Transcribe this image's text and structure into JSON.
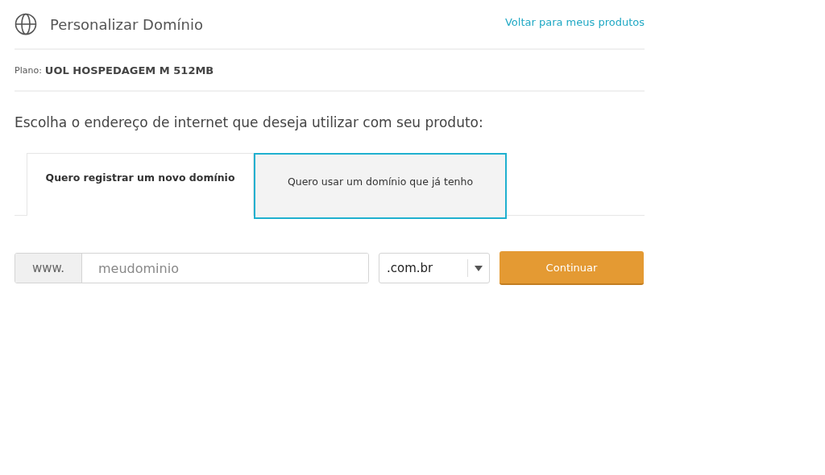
{
  "header": {
    "title": "Personalizar Domínio",
    "back_link": "Voltar para meus produtos"
  },
  "plan": {
    "label": "Plano:",
    "value": "UOL HOSPEDAGEM M 512MB"
  },
  "prompt": "Escolha o endereço de internet que deseja utilizar com seu produto:",
  "tabs": [
    {
      "label": "Quero registrar um novo domínio",
      "selected": true,
      "focused": false
    },
    {
      "label": "Quero usar um domínio que já tenho",
      "selected": false,
      "focused": true
    }
  ],
  "domain_form": {
    "prefix": "www.",
    "placeholder": "meudominio",
    "extension": ".com.br",
    "button": "Continuar"
  }
}
